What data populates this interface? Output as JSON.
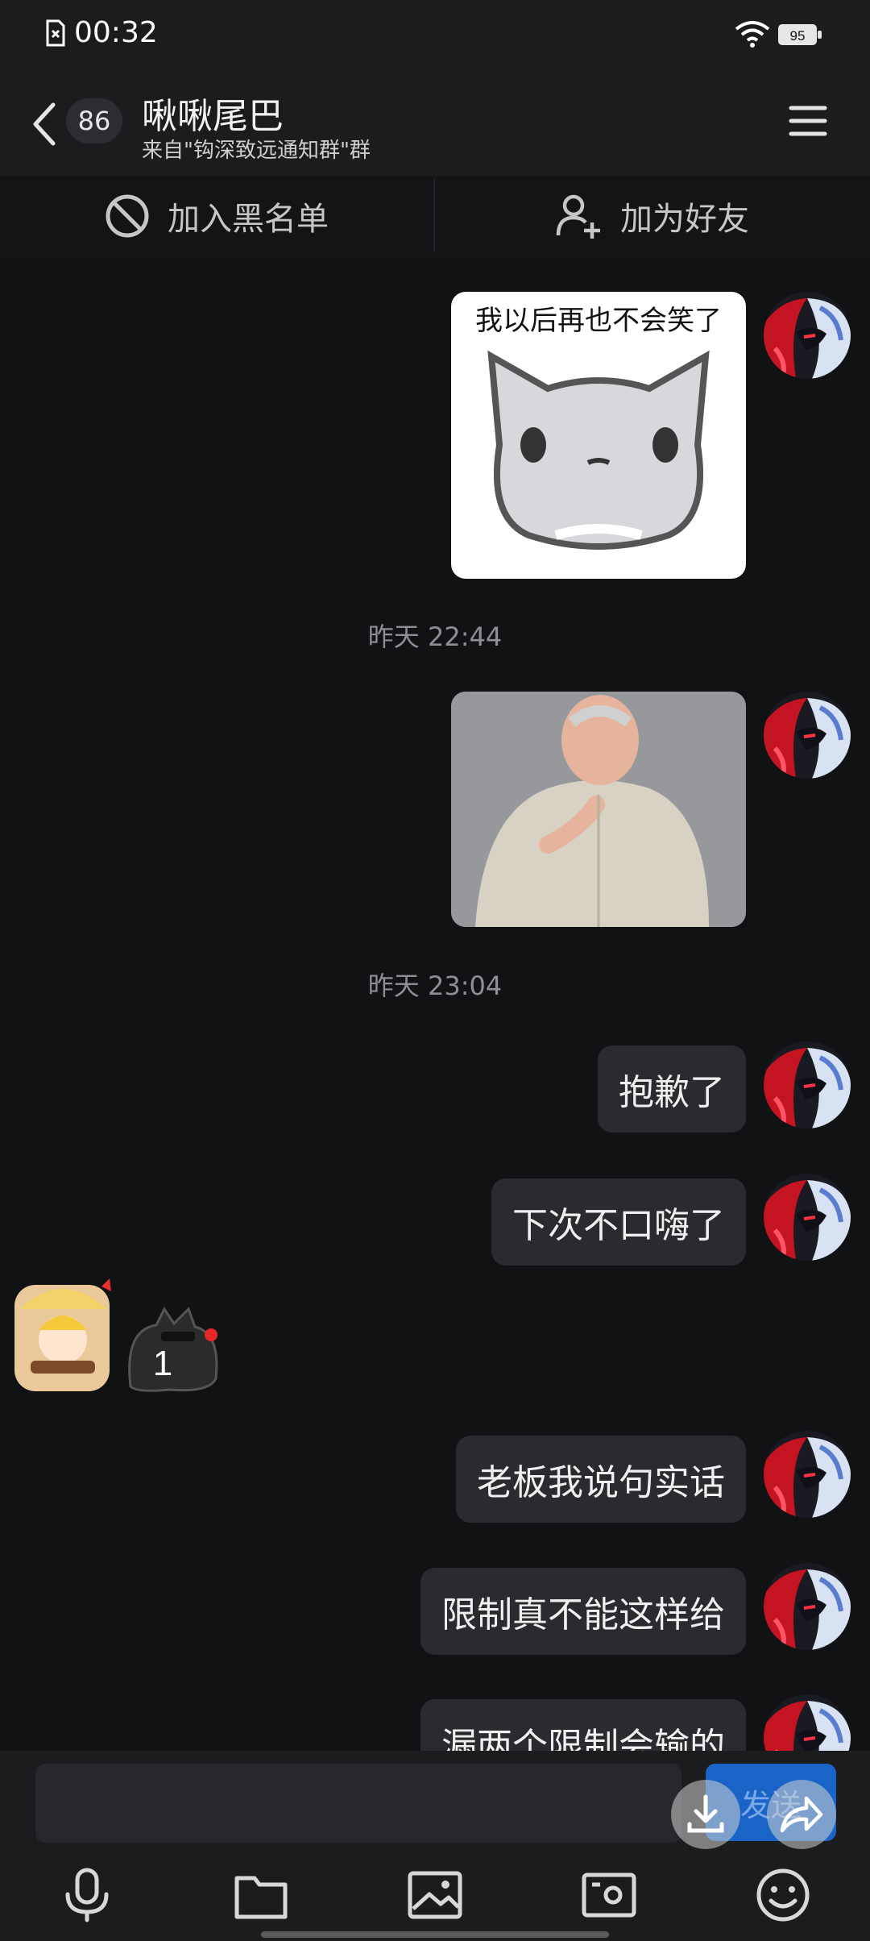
{
  "status": {
    "time": "00:32",
    "battery": "95"
  },
  "header": {
    "unread_count": "86",
    "title": "啾啾尾巴",
    "subtitle": "来自\"钩深致远通知群\"群"
  },
  "actions": {
    "block": "加入黑名单",
    "add_friend": "加为好友"
  },
  "sticker1_caption": "我以后再也不会笑了",
  "timestamps": [
    "昨天 22:44",
    "昨天 23:04"
  ],
  "messages": [
    "抱歉了",
    "下次不口嗨了",
    "老板我说句实话",
    "限制真不能这样给",
    "漏两个限制会输的"
  ],
  "incoming_sticker_number": "1",
  "composer": {
    "send_label": "发送",
    "placeholder": ""
  },
  "colors": {
    "background": "#111214",
    "bubble": "#2a2b2e",
    "accent": "#1a64c8"
  }
}
